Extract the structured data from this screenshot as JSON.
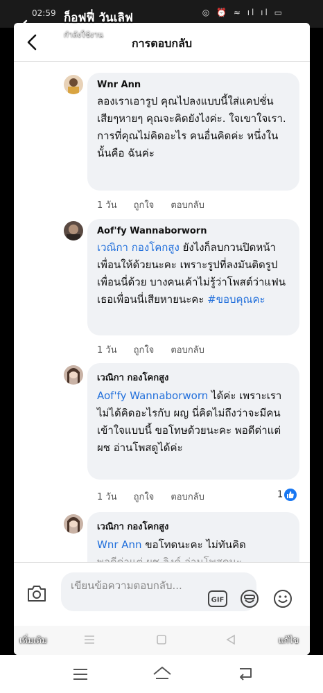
{
  "status": {
    "time": "02:59",
    "right": "◎ ⏰ ≈ ıl ıl ▭"
  },
  "story": {
    "name": "ก็อฟฟี่ วันเลิฟ",
    "sub": "กำลังใช้งาน"
  },
  "header": {
    "title": "การตอบกลับ"
  },
  "comments": [
    {
      "name": "Wnr Ann",
      "mention": "",
      "text": "ลองเราเอารูป คุณไปลงแบบนี้ใส่แคปชั่นเสียๆหายๆ คุณจะคิดยังไงค่ะ. ใจเขาใจเรา. การที่คุณไม่คิดอะไร คนอื่นคิดค่ะ หนึ่งในนั้นคือ ฉันค่ะ",
      "time": "1 วัน",
      "like": "ถูกใจ",
      "reply": "ตอบกลับ"
    },
    {
      "name": "Aof'fy Wannaborworn",
      "mention": "เวณิกา กองโคกสูง",
      "text": " ยังไงก็ลบกวนปิดหน้าเพื่อนให้ด้วยนะคะ เพราะรูปที่ลงมันติดรูปเพื่อนนี่ด้วย บางคนเค้าไม่รู้ว่าโพสต์ว่าแฟนเธอเพื่อนนี่เสียหายนะคะ ",
      "hashtag": "#ขอบคุณคะ",
      "time": "1 วัน",
      "like": "ถูกใจ",
      "reply": "ตอบกลับ"
    },
    {
      "name": "เวณิกา กองโคกสูง",
      "mention": "Aof'fy Wannaborworn",
      "text": " ได้ค่ะ เพราะเราไม่ได้คิดอะไรกับ ผญ นี่คิดไม่ถึงว่าจะมีคนเข้าใจแบบนี้ ขอโทษด้วยนะคะ พอดีด่าแต่ ผช อ่านโพสดูได้ค่ะ",
      "time": "1 วัน",
      "like": "ถูกใจ",
      "reply": "ตอบกลับ",
      "reactions": "1"
    },
    {
      "name": "เวณิกา กองโคกสูง",
      "mention": "Wnr Ann",
      "text": " ขอโทดนะคะ ไม่ทันคิด",
      "text2": "พอดีด่าแต่ ผช ลิงค์ อ่านโพสดูนะ"
    }
  ],
  "composer": {
    "placeholder": "เขียนข้อความตอบกลับ..."
  },
  "story_bar": {
    "left": "เพิ่มเติม",
    "right": "แก้ไข"
  },
  "colors": {
    "accent": "#216fdb",
    "bubble": "#f0f2f5",
    "like": "#1877f2"
  },
  "icons": [
    "back-arrow-icon",
    "camera-icon",
    "gif-icon",
    "sticker-icon",
    "emoji-icon",
    "pencil-icon",
    "like-icon",
    "menu-icon",
    "home-icon",
    "return-icon"
  ]
}
